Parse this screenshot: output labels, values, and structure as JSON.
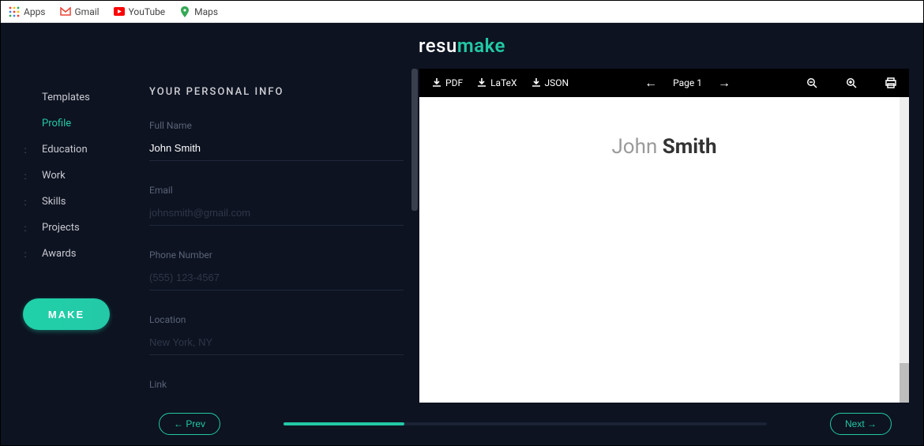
{
  "bookmarks": {
    "apps": "Apps",
    "gmail": "Gmail",
    "youtube": "YouTube",
    "maps": "Maps"
  },
  "logo": {
    "first": "resu",
    "second": "make"
  },
  "sidebar": {
    "items": [
      {
        "label": "Templates"
      },
      {
        "label": "Profile"
      },
      {
        "label": "Education"
      },
      {
        "label": "Work"
      },
      {
        "label": "Skills"
      },
      {
        "label": "Projects"
      },
      {
        "label": "Awards"
      }
    ],
    "make_label": "MAKE"
  },
  "form": {
    "title": "YOUR PERSONAL INFO",
    "fields": {
      "fullname": {
        "label": "Full Name",
        "value": "John Smith",
        "placeholder": ""
      },
      "email": {
        "label": "Email",
        "value": "",
        "placeholder": "johnsmith@gmail.com"
      },
      "phone": {
        "label": "Phone Number",
        "value": "",
        "placeholder": "(555) 123-4567"
      },
      "location": {
        "label": "Location",
        "value": "",
        "placeholder": "New York, NY"
      },
      "link": {
        "label": "Link",
        "value": "",
        "placeholder": ""
      }
    }
  },
  "toolbar": {
    "pdf": "PDF",
    "latex": "LaTeX",
    "json": "JSON",
    "page": "Page 1"
  },
  "preview": {
    "first_name": "John",
    "last_name": "Smith"
  },
  "footer": {
    "prev": "← Prev",
    "next": "Next →"
  }
}
